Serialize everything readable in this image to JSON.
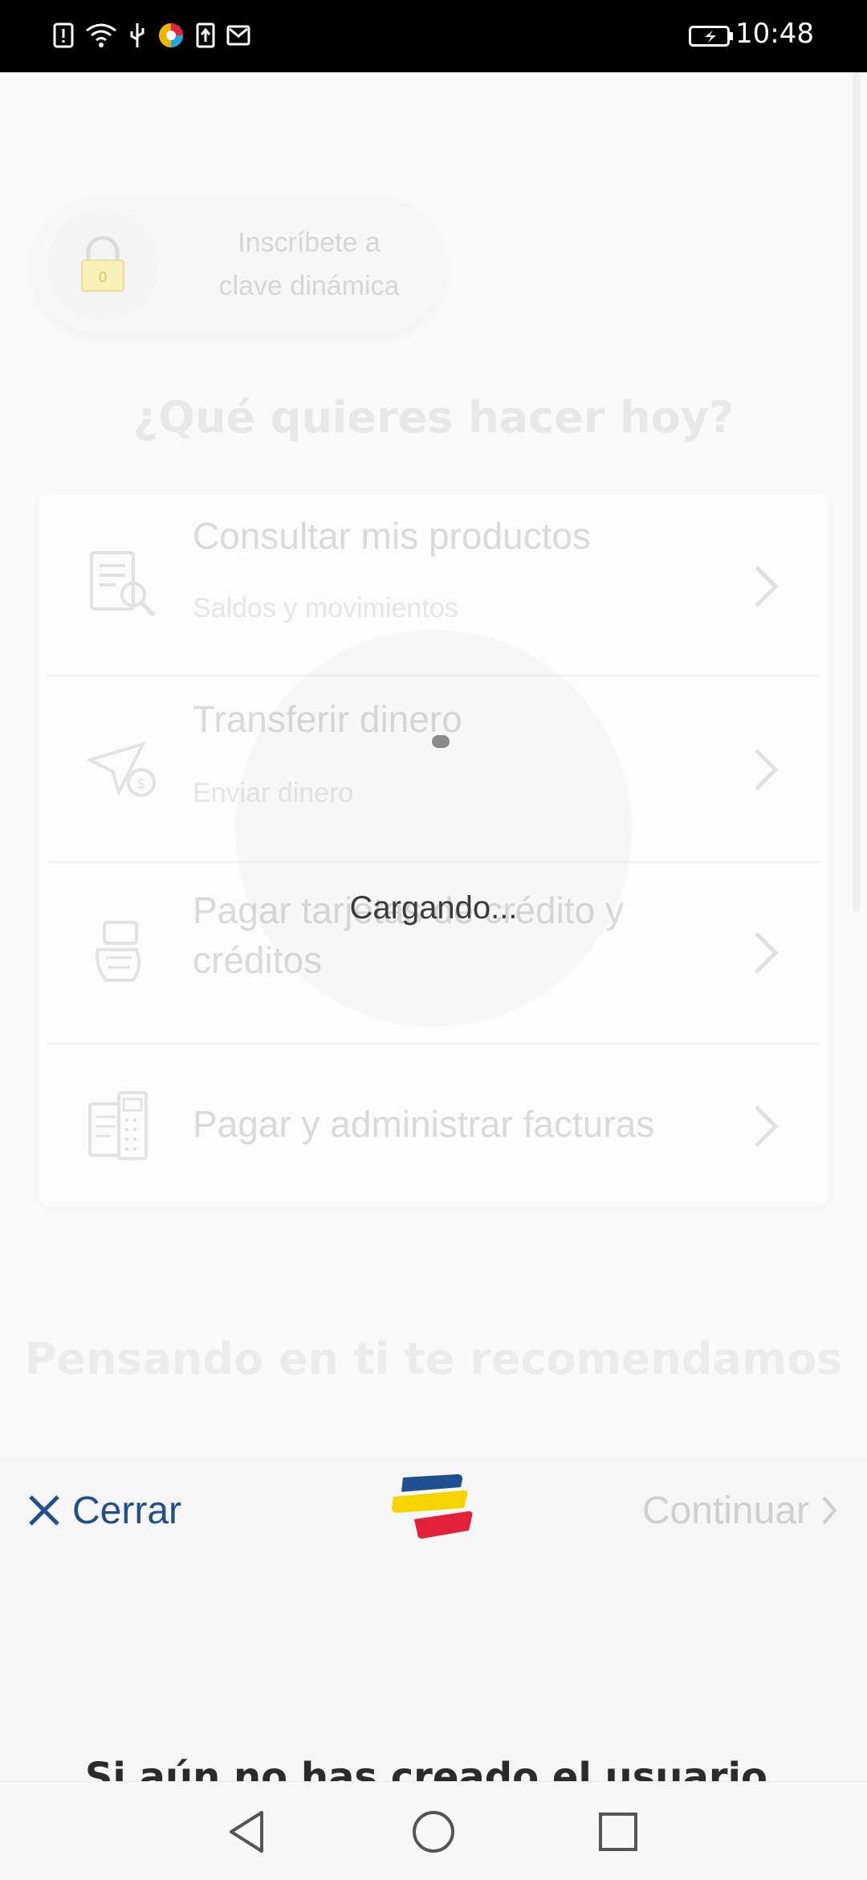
{
  "status_bar": {
    "time": "10:48",
    "icons": [
      "alert-icon",
      "wifi-icon",
      "usb-icon",
      "app-icon",
      "upload-icon",
      "mail-icon",
      "battery-icon"
    ]
  },
  "background": {
    "enroll_line1": "Inscríbete a",
    "enroll_line2": "clave dinámica",
    "lock_digit": "0",
    "question": "¿Qué quieres hacer hoy?",
    "menu": [
      {
        "title": "Consultar mis productos",
        "subtitle": "Saldos y movimientos",
        "icon": "document-search-icon"
      },
      {
        "title": "Transferir dinero",
        "subtitle": "Enviar dinero",
        "icon": "paper-plane-money-icon"
      },
      {
        "title": "Pagar tarjetas de crédito y créditos",
        "subtitle": "",
        "icon": "card-hand-icon"
      },
      {
        "title": "Pagar y administrar facturas",
        "subtitle": "",
        "icon": "bill-calculator-icon"
      }
    ],
    "recommend_heading": "Pensando en ti te recomendamos"
  },
  "loader": {
    "text": "Cargando..."
  },
  "sheet": {
    "close_label": "Cerrar",
    "continue_label": "Continuar",
    "cut_text": "Si aún no has creado el usuario, ingresa el"
  },
  "nav": {
    "buttons": [
      "back-icon",
      "home-icon",
      "recents-icon"
    ]
  },
  "colors": {
    "brand_blue": "#1f4f8f",
    "brand_yellow": "#f5d400",
    "brand_red": "#e3203a"
  }
}
